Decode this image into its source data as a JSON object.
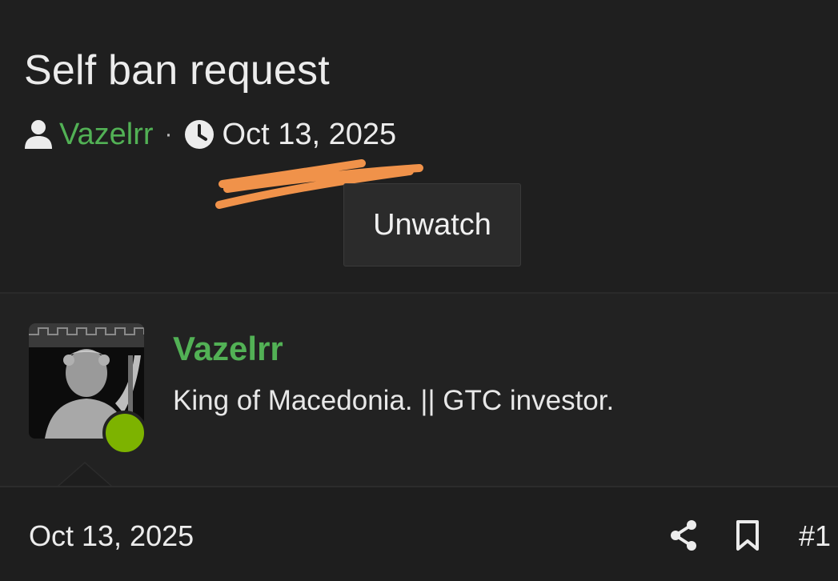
{
  "thread": {
    "title": "Self ban request",
    "author": "Vazelrr",
    "separator": "·",
    "date": "Oct 13, 2025",
    "watch_button_label": "Unwatch"
  },
  "post": {
    "username": "Vazelrr",
    "user_title": "King of Macedonia. || GTC investor.",
    "online_status_color": "#7db300",
    "date": "Oct 13, 2025",
    "post_number": "#1",
    "icons": [
      "user-icon",
      "clock-icon",
      "share-icon",
      "bookmark-icon"
    ]
  },
  "colors": {
    "background": "#1e1e1e",
    "username_green": "#52b155",
    "annotation_orange": "#f0924a"
  }
}
